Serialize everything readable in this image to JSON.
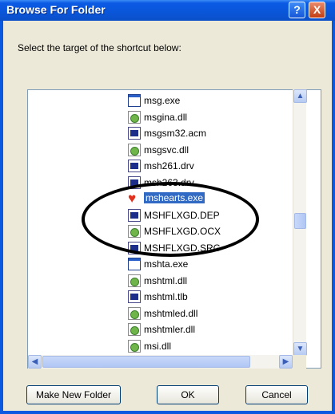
{
  "window": {
    "title": "Browse For Folder",
    "help_label": "?",
    "close_label": "X"
  },
  "prompt": "Select the target of the shortcut below:",
  "files": [
    {
      "name": "msg.exe",
      "icon": "exe-icon"
    },
    {
      "name": "msgina.dll",
      "icon": "dll-icon"
    },
    {
      "name": "msgsm32.acm",
      "icon": "system-file-icon"
    },
    {
      "name": "msgsvc.dll",
      "icon": "dll-icon"
    },
    {
      "name": "msh261.drv",
      "icon": "system-file-icon"
    },
    {
      "name": "msh263.drv",
      "icon": "system-file-icon"
    },
    {
      "name": "mshearts.exe",
      "icon": "heart-icon",
      "selected": true
    },
    {
      "name": "MSHFLXGD.DEP",
      "icon": "system-file-icon"
    },
    {
      "name": "MSHFLXGD.OCX",
      "icon": "dll-icon"
    },
    {
      "name": "MSHFLXGD.SRG",
      "icon": "system-file-icon"
    },
    {
      "name": "mshta.exe",
      "icon": "exe-icon"
    },
    {
      "name": "mshtml.dll",
      "icon": "dll-icon"
    },
    {
      "name": "mshtml.tlb",
      "icon": "system-file-icon"
    },
    {
      "name": "mshtmled.dll",
      "icon": "dll-icon"
    },
    {
      "name": "mshtmler.dll",
      "icon": "dll-icon"
    },
    {
      "name": "msi.dll",
      "icon": "dll-icon"
    }
  ],
  "buttons": {
    "new_folder": "Make New Folder",
    "ok": "OK",
    "cancel": "Cancel"
  },
  "colors": {
    "titlebar": "#0a56d9",
    "selection": "#316ac5",
    "annotation": "#000000"
  }
}
